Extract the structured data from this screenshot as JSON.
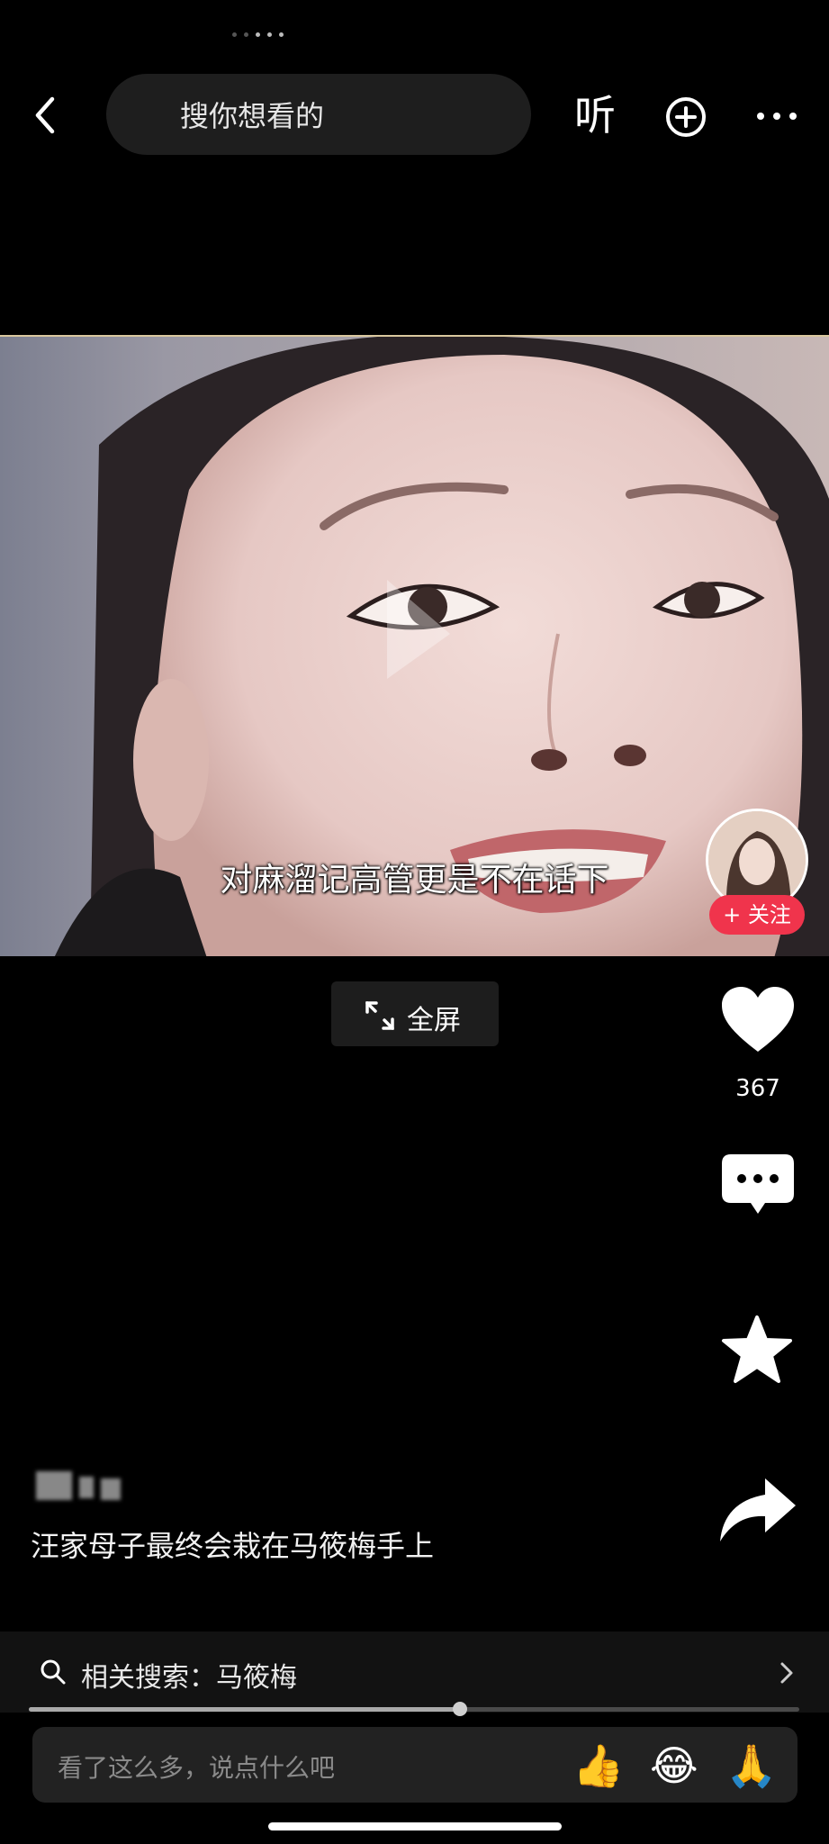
{
  "top_bar": {
    "search_placeholder": "搜你想看的",
    "listen_label": "听"
  },
  "video": {
    "subtitle": "对麻溜记高管更是不在话下",
    "follow_label": "+ 关注",
    "fullscreen_label": "全屏"
  },
  "actions": {
    "like_count": "367"
  },
  "post": {
    "caption": "汪家母子最终会栽在马筱梅手上"
  },
  "related_search": {
    "label": "相关搜索：马筱梅",
    "progress": 0.56
  },
  "comment_input": {
    "placeholder": "看了这么多，说点什么吧",
    "emojis": [
      "👍",
      "😂",
      "🙏"
    ]
  },
  "colors": {
    "background": "#000000",
    "follow_red": "#f0344c",
    "panel": "#1e1e1e"
  }
}
